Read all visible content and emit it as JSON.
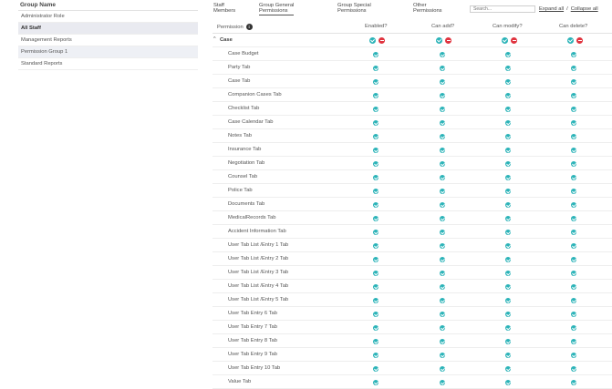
{
  "left_panel": {
    "header": "Group Name",
    "groups": [
      {
        "label": "Administrator Role",
        "selected": false
      },
      {
        "label": "All Staff",
        "selected": true
      },
      {
        "label": "Management Reports",
        "selected": false
      },
      {
        "label": "Permission Group 1",
        "selected": false
      },
      {
        "label": "Standard Reports",
        "selected": false
      }
    ]
  },
  "tabs": [
    {
      "line1": "Staff",
      "line2": "Members",
      "active": false
    },
    {
      "line1": "Group General",
      "line2": "Permissions",
      "active": true
    },
    {
      "line1": "Group Special",
      "line2": "Permissions",
      "active": false
    },
    {
      "line1": "Other",
      "line2": "Permissions",
      "active": false
    }
  ],
  "search": {
    "placeholder": "Search..."
  },
  "expand_all": "Expand all",
  "separator": "/",
  "collapse_all": "Collapse all",
  "table": {
    "columns": {
      "permission": "Permission",
      "enabled": "Enabled?",
      "add": "Can add?",
      "modify": "Can modify?",
      "delete": "Can delete?"
    },
    "info_icon": "i",
    "section": {
      "label": "Case",
      "caret": "^"
    },
    "rows": [
      "Case Budget",
      "Party Tab",
      "Case Tab",
      "Companion Cases Tab",
      "Checklist Tab",
      "Case Calendar Tab",
      "Notes Tab",
      "Insurance Tab",
      "Negotiation Tab",
      "Counsel Tab",
      "Police Tab",
      "Documents Tab",
      "MedicalRecords Tab",
      "Accident Information Tab",
      "User Tab List /Entry 1 Tab",
      "User Tab List /Entry 2 Tab",
      "User Tab List /Entry 3 Tab",
      "User Tab List /Entry 4 Tab",
      "User Tab List /Entry 5 Tab",
      "User Tab Entry 6 Tab",
      "User Tab Entry 7 Tab",
      "User Tab Entry 8 Tab",
      "User Tab Entry 9 Tab",
      "User Tab Entry 10 Tab",
      "Value Tab"
    ]
  },
  "colors": {
    "check": "#2bb3b8",
    "cross": "#e0343f",
    "selected_bg": "#e9eaf0"
  }
}
